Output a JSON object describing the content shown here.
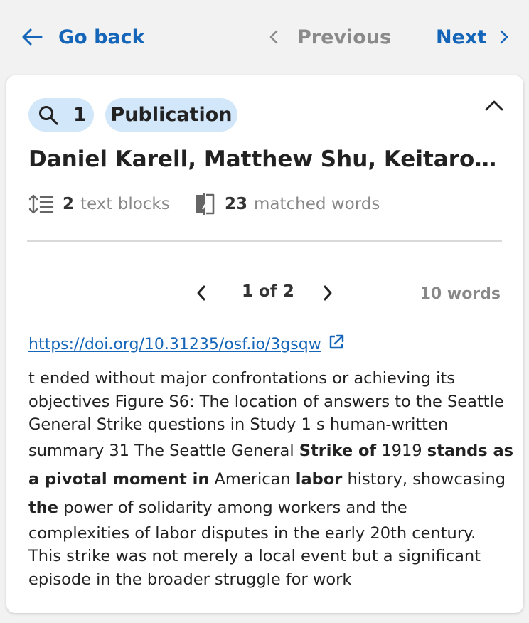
{
  "nav": {
    "back_label": "Go back",
    "previous_label": "Previous",
    "next_label": "Next",
    "previous_disabled": true
  },
  "card": {
    "search_count": "1",
    "type_label": "Publication",
    "title": "Daniel Karell, Matthew Shu, Keitaro Okura, Thomas R. Davidson",
    "text_blocks_count": "2",
    "text_blocks_label": "text blocks",
    "matched_words_count": "23",
    "matched_words_label": "matched words",
    "pager": {
      "label": "1 of 2"
    },
    "word_count_label": "10 words",
    "doi_link": "https://doi.org/10.31235/osf.io/3gsqw",
    "excerpt_lines": [
      [
        {
          "t": "t ended without major confrontations or achieving its",
          "b": false
        }
      ],
      [
        {
          "t": "objectives Figure S6: The location of answers to the Seattle",
          "b": false
        }
      ],
      [
        {
          "t": "General Strike questions in Study 1 s human-written",
          "b": false
        }
      ],
      [
        {
          "t": "summary 31 The Seattle General ",
          "b": false
        },
        {
          "t": "Strike of",
          "b": true
        },
        {
          "t": " 1919 ",
          "b": false
        },
        {
          "t": "stands as",
          "b": true
        }
      ],
      [
        {
          "t": "a pivotal moment in",
          "b": true
        },
        {
          "t": " American ",
          "b": false
        },
        {
          "t": "labor",
          "b": true
        },
        {
          "t": " history, showcasing",
          "b": false
        }
      ],
      [
        {
          "t": "the",
          "b": true
        },
        {
          "t": " power of solidarity among workers and the",
          "b": false
        }
      ],
      [
        {
          "t": "complexities of labor disputes in the early 20th century.",
          "b": false
        }
      ],
      [
        {
          "t": "This strike was not merely a local event but a significant",
          "b": false
        }
      ],
      [
        {
          "t": "episode in the broader struggle for work",
          "b": false
        }
      ]
    ]
  },
  "colors": {
    "accent": "#1565b8",
    "pill_bg": "#d2e7f9",
    "muted_text": "#888888",
    "page_bg": "#f2f2f2"
  },
  "icons": {
    "back": "arrow-left-icon",
    "previous": "chevron-left-icon",
    "next": "chevron-right-icon",
    "collapse": "chevron-up-icon",
    "search": "search-icon",
    "text_blocks": "line-spacing-icon",
    "matched_words": "compare-icon",
    "external_link": "external-link-icon"
  }
}
